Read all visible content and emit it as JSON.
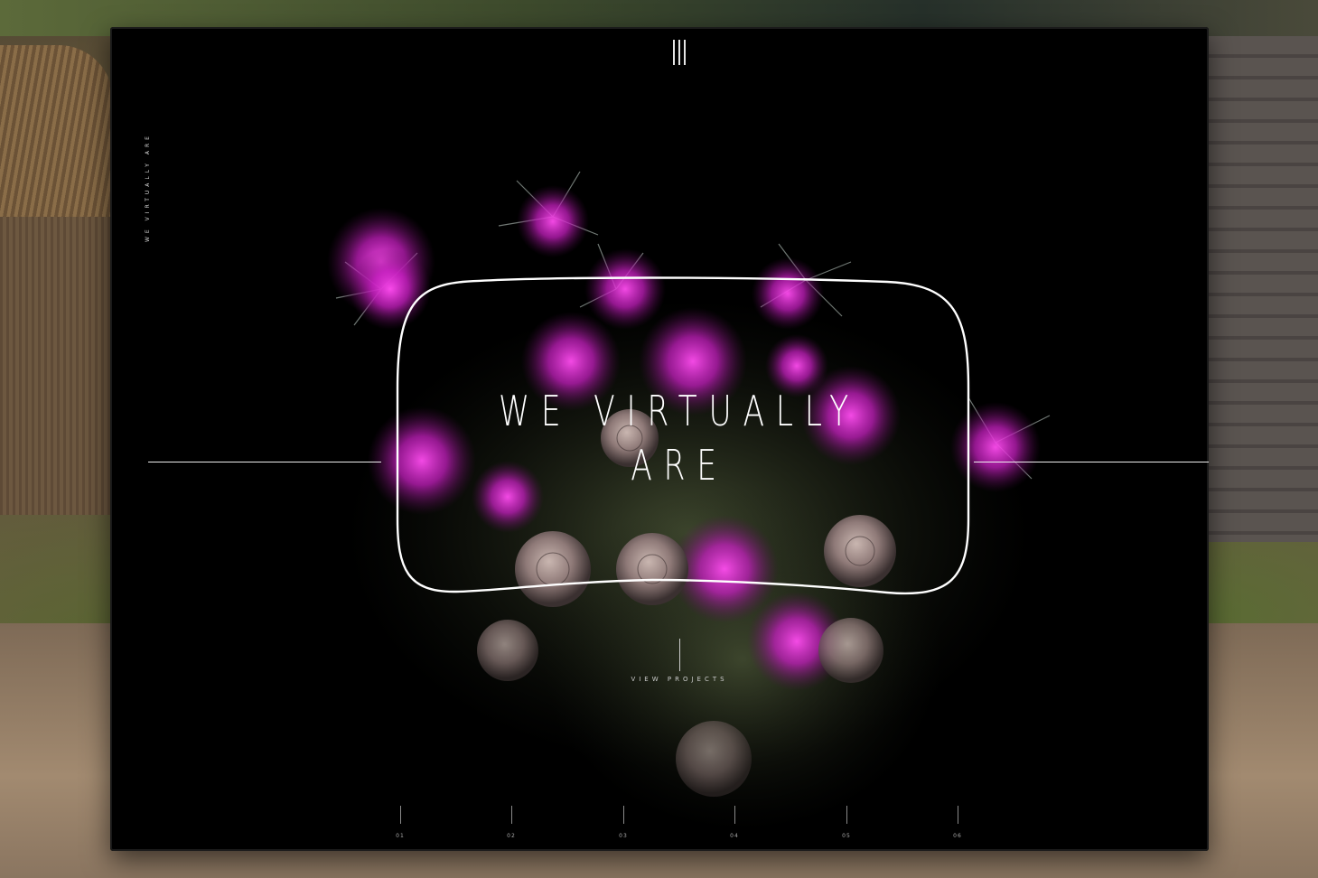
{
  "site": {
    "vertical_tagline": "WE VIRTUALLY ARE",
    "headline_line1": "WE VIRTUALLY",
    "headline_line2": "ARE",
    "cta_label": "VIEW PROJECTS",
    "pager": [
      "01",
      "02",
      "03",
      "04",
      "05",
      "06"
    ],
    "active_page_index": 0
  },
  "colors": {
    "background": "#000000",
    "accent_magenta": "#d42ad0",
    "text": "#ffffff"
  },
  "icons": {
    "menu": "menu-icon"
  }
}
